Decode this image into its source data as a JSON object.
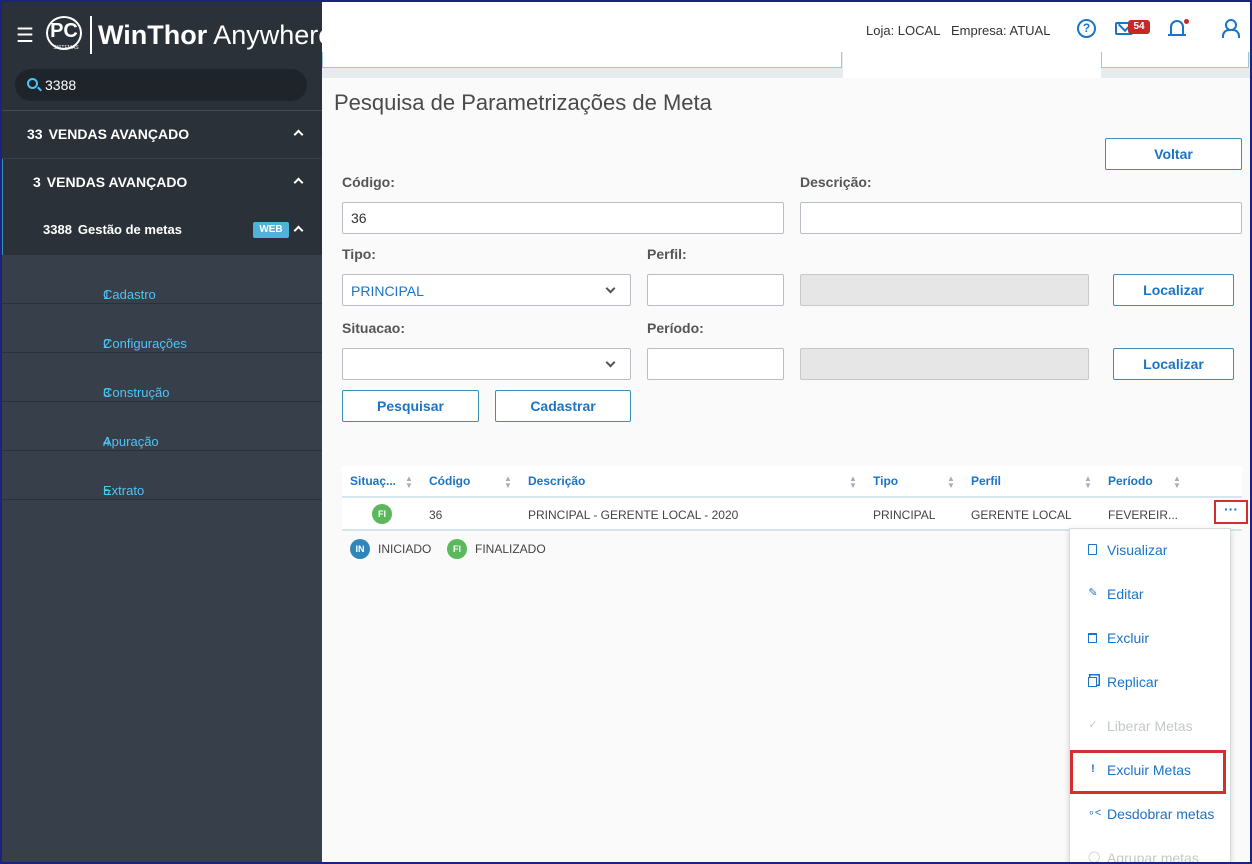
{
  "sidebar": {
    "search_value": "3388",
    "brand_bold": "WinThor",
    "brand_light": "Anywhere",
    "logo_text": "PC",
    "logo_sub": "SISTEMAS",
    "level1": {
      "num": "33",
      "label": "VENDAS AVANÇADO"
    },
    "level2": {
      "num": "3",
      "label": "VENDAS AVANÇADO"
    },
    "level3": {
      "num": "3388",
      "label": "Gestão de metas",
      "badge": "WEB"
    },
    "items": [
      {
        "num": "1",
        "label": "Cadastro"
      },
      {
        "num": "2",
        "label": "Configurações"
      },
      {
        "num": "3",
        "label": "Construção"
      },
      {
        "num": "4",
        "label": "Apuração"
      },
      {
        "num": "5",
        "label": "Extrato"
      }
    ]
  },
  "header": {
    "loja": "Loja: LOCAL",
    "empresa": "Empresa: ATUAL",
    "help": "?",
    "mail_count": "54"
  },
  "page": {
    "title": "Pesquisa de Parametrizações de Meta",
    "voltar": "Voltar",
    "codigo_label": "Código:",
    "codigo_value": "36",
    "descricao_label": "Descrição:",
    "descricao_value": "",
    "tipo_label": "Tipo:",
    "tipo_value": "PRINCIPAL",
    "perfil_label": "Perfil:",
    "perfil_value": "",
    "localizar1": "Localizar",
    "situacao_label": "Situacao:",
    "situacao_value": "",
    "periodo_label": "Período:",
    "periodo_value": "",
    "localizar2": "Localizar",
    "pesquisar": "Pesquisar",
    "cadastrar": "Cadastrar"
  },
  "table": {
    "headers": [
      "Situaç...",
      "Código",
      "Descrição",
      "Tipo",
      "Perfil",
      "Período"
    ],
    "rows": [
      {
        "situacao": "FI",
        "codigo": "36",
        "descricao": "PRINCIPAL - GERENTE LOCAL - 2020",
        "tipo": "PRINCIPAL",
        "perfil": "GERENTE LOCAL",
        "periodo": "FEVEREIR..."
      }
    ],
    "more": "···"
  },
  "legend": [
    {
      "code": "IN",
      "label": "INICIADO"
    },
    {
      "code": "FI",
      "label": "FINALIZADO"
    }
  ],
  "menu": {
    "items": [
      {
        "label": "Visualizar",
        "icon": "document-icon"
      },
      {
        "label": "Editar",
        "icon": "pencil-icon"
      },
      {
        "label": "Excluir",
        "icon": "trash-icon"
      },
      {
        "label": "Replicar",
        "icon": "copy-icon"
      },
      {
        "label": "Liberar Metas",
        "icon": "check-icon"
      },
      {
        "label": "Excluir Metas",
        "icon": "exclamation-icon"
      },
      {
        "label": "Desdobrar metas",
        "icon": "share-icon"
      },
      {
        "label": "Agrupar metas",
        "icon": "group-icon"
      }
    ]
  },
  "colors": {
    "sidebar": "#37404a",
    "sidebar_dark": "#2a3138",
    "accent": "#1b74c5",
    "highlight": "#d32f2f",
    "status_fi": "#5cb85c",
    "status_in": "#2f86b8"
  }
}
